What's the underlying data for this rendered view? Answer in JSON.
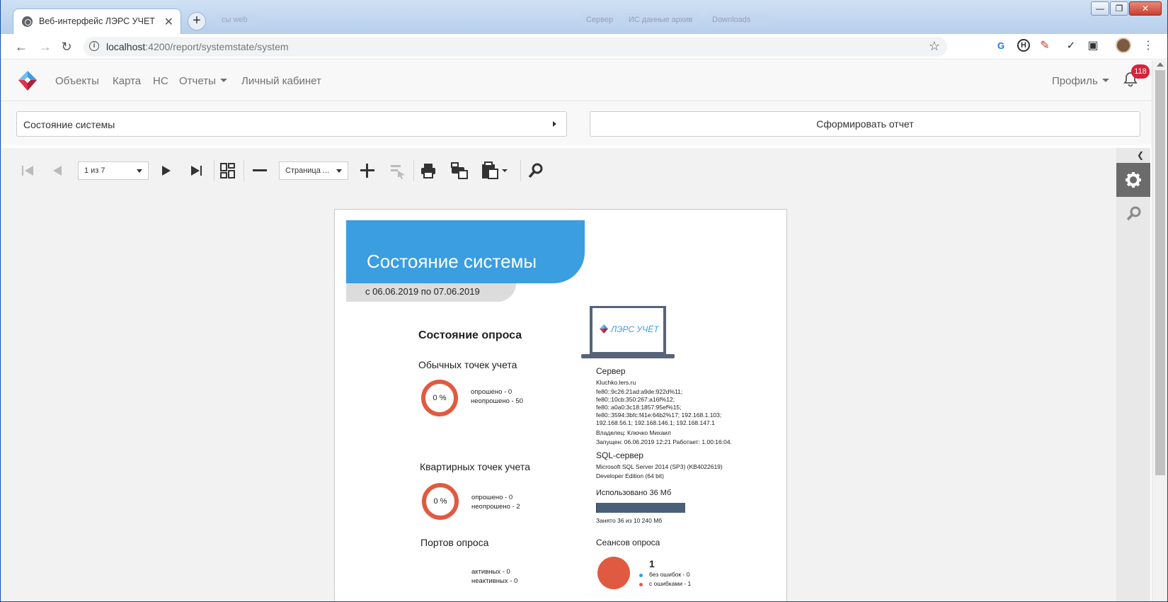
{
  "browser": {
    "tab_title": "Веб-интерфейс ЛЭРС УЧЕТ",
    "tab_close": "✕",
    "new_tab": "+",
    "bg_tabs": [
      "сы web",
      "Сервер",
      "ИС данные архив",
      "Downloads"
    ],
    "url_host": "localhost",
    "url_path": ":4200/report/systemstate/system",
    "window_buttons": [
      "—",
      "❐",
      "✕"
    ]
  },
  "app": {
    "nav": [
      "Объекты",
      "Карта",
      "НС",
      "Отчеты",
      "Личный кабинет"
    ],
    "profile": "Профиль",
    "notifications": "118"
  },
  "filter": {
    "report_select": "Состояние системы",
    "make_report": "Сформировать отчет"
  },
  "viewer": {
    "page_select": "1 из 7",
    "zoom_select": "Страница ..."
  },
  "report": {
    "title": "Состояние системы",
    "period": "с 06.06.2019 по 07.06.2019",
    "poll_title": "Состояние опроса",
    "logo_text": "ЛЭРС УЧЁТ",
    "regular": {
      "label": "Обычных точек учета",
      "percent": "0 %",
      "polled": "опрошено - 0",
      "not_polled": "неопрошено - 50"
    },
    "apartment": {
      "label": "Квартирных точек учета",
      "percent": "0 %",
      "polled": "опрошено - 0",
      "not_polled": "неопрошено - 2"
    },
    "ports": {
      "label": "Портов опроса",
      "active": "активных - 0",
      "inactive": "неактивных - 0"
    },
    "server": {
      "label": "Сервер",
      "host": "Kluchko.lers.ru",
      "addresses": [
        "fe80::9c26:21ad:a9de:922d%11;",
        "fe80::10cb:350:267:a16f%12;",
        "fe80::a0a0:3c18:1857:95ef%15;",
        "fe80::3594:3bfc:f41e:64b2%17; 192.168.1.103;",
        "192.168.56.1; 192.168.146.1; 192.168.147.1"
      ],
      "owner": "Владелец: Ключко Михаил",
      "started": "Запущен:  06.06.2019 12:21   Работает:  1.00:16:04."
    },
    "sql": {
      "label": "SQL-сервер",
      "line1": "Microsoft SQL Server 2014 (SP3) (KB4022619)",
      "line2": "Developer Edition (64 bit)",
      "used_label": "Использовано 36 Мб",
      "used_fraction": 0.0035,
      "occupied": "Занято 36 из 10 240 Мб"
    },
    "sessions": {
      "label": "Сеансов опроса",
      "count": "1",
      "ok": "без ошибок - 0",
      "errors": "с ошибками - 1"
    }
  }
}
